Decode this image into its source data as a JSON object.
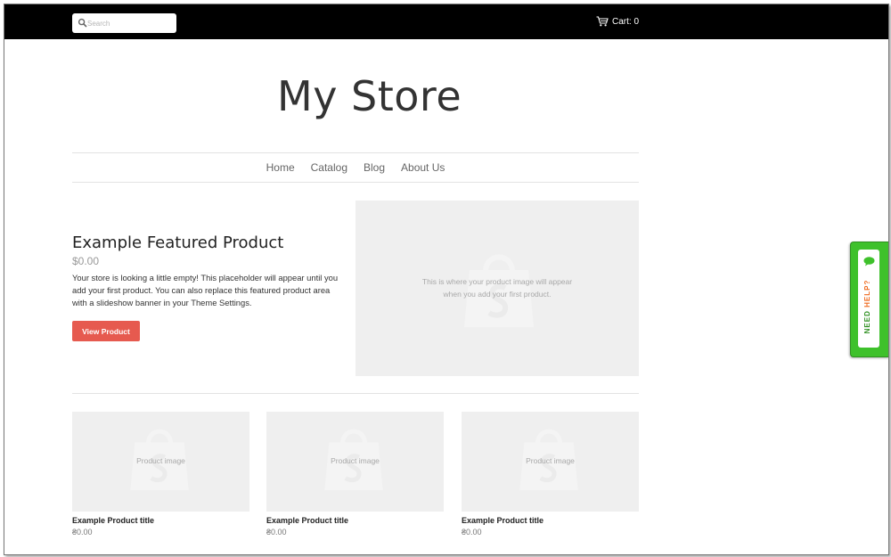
{
  "header": {
    "search_placeholder": "Search",
    "cart_label": "Cart: 0"
  },
  "site": {
    "title": "My Store"
  },
  "nav": {
    "items": [
      "Home",
      "Catalog",
      "Blog",
      "About Us"
    ]
  },
  "featured": {
    "title": "Example Featured Product",
    "price": "$0.00",
    "description": "Your store is looking a little empty! This placeholder will appear until you add your first product. You can also replace this featured product area with a slideshow banner in your Theme Settings.",
    "button_label": "View Product",
    "image_text_line1": "This is where your product image will appear",
    "image_text_line2": "when you add your first product."
  },
  "products": [
    {
      "image_text": "Product image",
      "title": "Example Product title",
      "price": "₴0.00"
    },
    {
      "image_text": "Product image",
      "title": "Example Product title",
      "price": "₴0.00"
    },
    {
      "image_text": "Product image",
      "title": "Example Product title",
      "price": "₴0.00"
    }
  ],
  "help_widget": {
    "need": "NEED",
    "help": "HELP?"
  },
  "colors": {
    "topbar": "#000000",
    "accent_button": "#e65a4f",
    "help_green": "#3ec12b",
    "placeholder_gray": "#efefef"
  },
  "icons": [
    "search-icon",
    "cart-icon",
    "shopify-bag-icon",
    "chat-bubble-icon"
  ]
}
